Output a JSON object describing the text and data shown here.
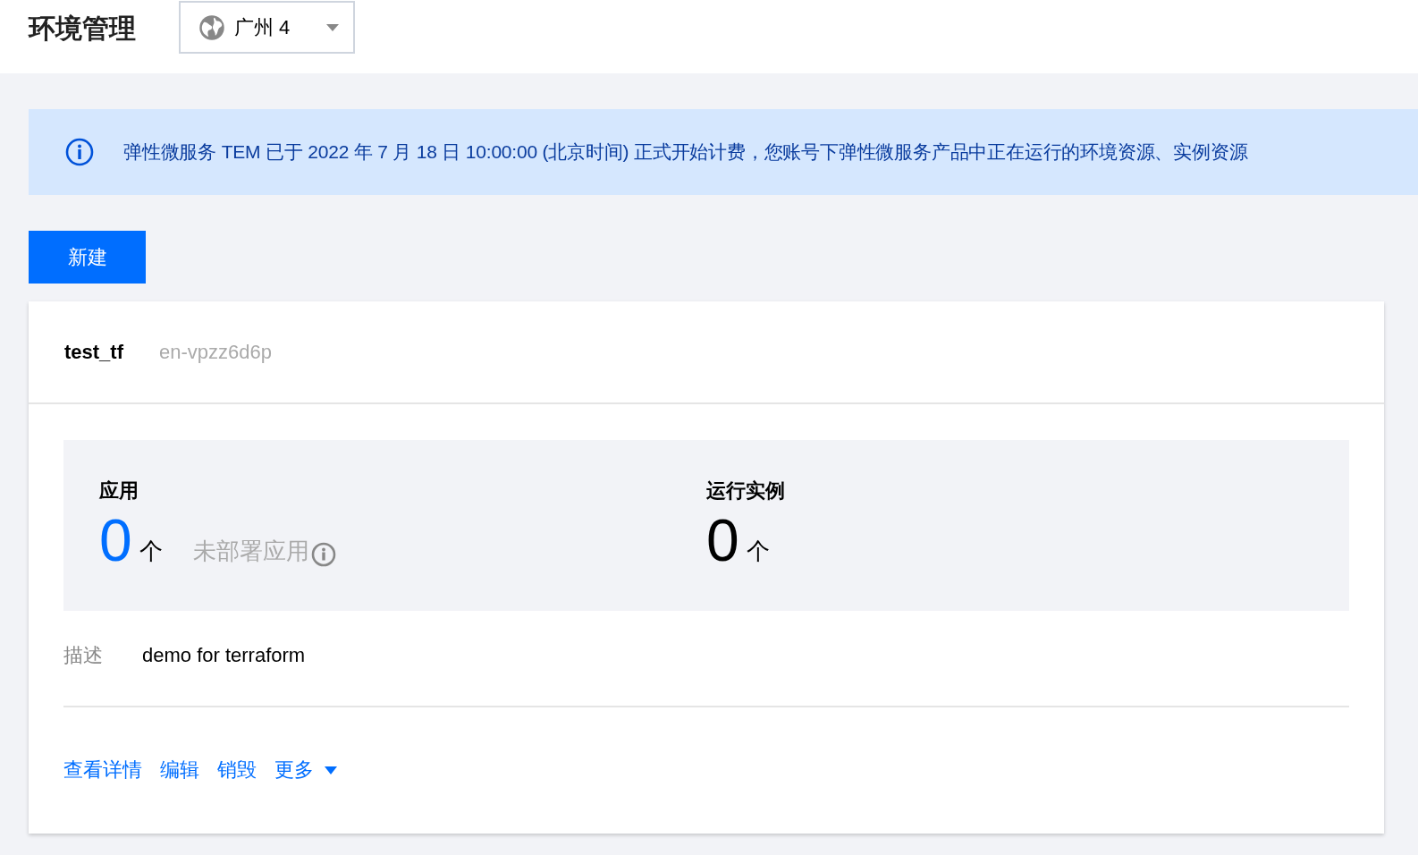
{
  "header": {
    "title": "环境管理",
    "region": {
      "label": "广州 4"
    }
  },
  "notice": {
    "text": "弹性微服务 TEM 已于 2022 年 7 月 18 日 10:00:00 (北京时间) 正式开始计费，您账号下弹性微服务产品中正在运行的环境资源、实例资源"
  },
  "create_button": "新建",
  "environment": {
    "name": "test_tf",
    "id": "en-vpzz6d6p",
    "stats": [
      {
        "label": "应用",
        "value": "0",
        "unit": "个",
        "kind": "accent",
        "note": "未部署应用"
      },
      {
        "label": "运行实例",
        "value": "0",
        "unit": "个",
        "kind": "plain"
      }
    ],
    "description": {
      "label": "描述",
      "value": "demo for terraform"
    },
    "actions": [
      {
        "label": "查看详情",
        "kind": "link"
      },
      {
        "label": "编辑",
        "kind": "link"
      },
      {
        "label": "销毁",
        "kind": "link"
      },
      {
        "label": "更多",
        "kind": "dropdown"
      }
    ]
  }
}
